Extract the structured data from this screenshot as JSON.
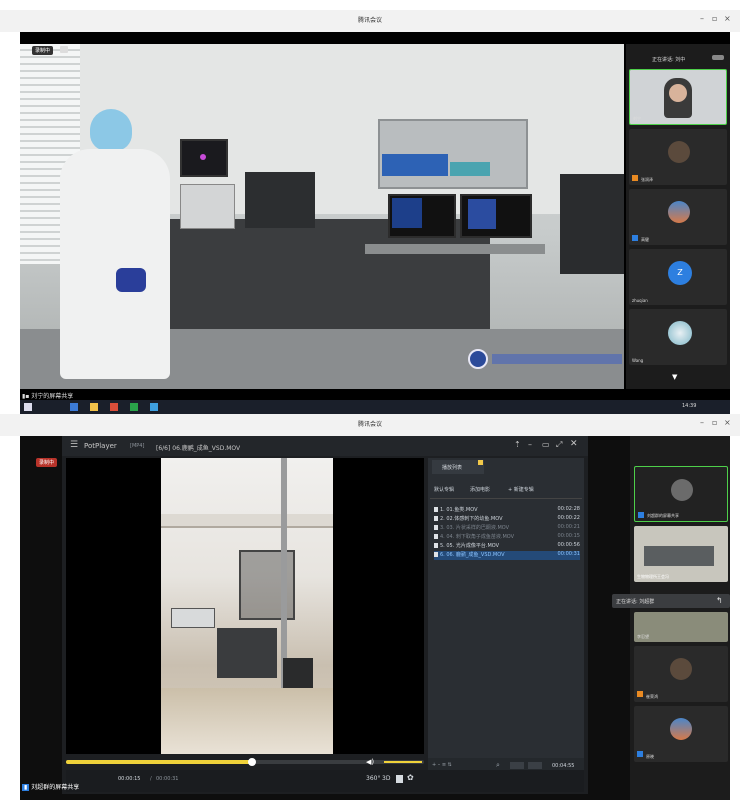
{
  "top": {
    "title": "腾讯会议",
    "recording": "录制中",
    "speaking": "正在讲话: 刘中",
    "share_label": "刘宁的屏幕共享",
    "tiles": [
      {
        "name": "刘宁",
        "color": "#9a9ea3"
      },
      {
        "name": "张润泽",
        "color": "#5b4a3c"
      },
      {
        "name": "高健",
        "color": "#4b86c9"
      },
      {
        "name": "zhuqian",
        "color": "#2d7fe0",
        "letter": "Z"
      },
      {
        "name": "Wang",
        "color": "#7fb7c7"
      }
    ],
    "taskbar_time": "14:39"
  },
  "bottom": {
    "title": "腾讯会议",
    "recording": "录制中",
    "player_name": "PotPlayer",
    "format": "[MP4]",
    "file_title": "[6/6] 06.鹿鹂_成鱼_VSD.MOV",
    "playlist_header": "播放列表",
    "tabs": [
      "默认专辑",
      "添加电影",
      "+ 新建专辑"
    ],
    "playlist": [
      {
        "name": "1. 01.鱼类.MOV",
        "dur": "00:02:28",
        "style": "normal"
      },
      {
        "name": "2. 02.体感刺下的幼鱼.MOV",
        "dur": "00:00:22",
        "style": "normal"
      },
      {
        "name": "3. 03. 片状采样的巴酮液.MOV",
        "dur": "00:00:21",
        "style": "dim"
      },
      {
        "name": "4. 04. 刺下取角子成鱼苗液.MOV",
        "dur": "00:00:15",
        "style": "dim"
      },
      {
        "name": "5. 05. 光片成像平台.MOV",
        "dur": "00:00:56",
        "style": "normal"
      },
      {
        "name": "6. 06. 鹿鹂_成鱼_VSD.MOV",
        "dur": "00:00:31",
        "style": "active"
      }
    ],
    "time_current": "00:00:15",
    "time_total": "00:00:31",
    "playlist_total": "00:04:55",
    "progress": 0.52,
    "speaking": "正在讲话: 刘超群",
    "share_label": "刘超群的屏幕共享",
    "tiles": [
      {
        "name": "刘超群的屏幕共享",
        "color": "#4a4a4a"
      },
      {
        "name": "生物物理所王会冯",
        "color": "#7a7a6a"
      },
      {
        "name": "李忍望",
        "color": "#8a8c7a"
      },
      {
        "name": "崔荣鸿",
        "color": "#5b4a3c"
      },
      {
        "name": "原晓",
        "color": "#4b86c9"
      }
    ],
    "controls": [
      "360°",
      "3D"
    ]
  }
}
